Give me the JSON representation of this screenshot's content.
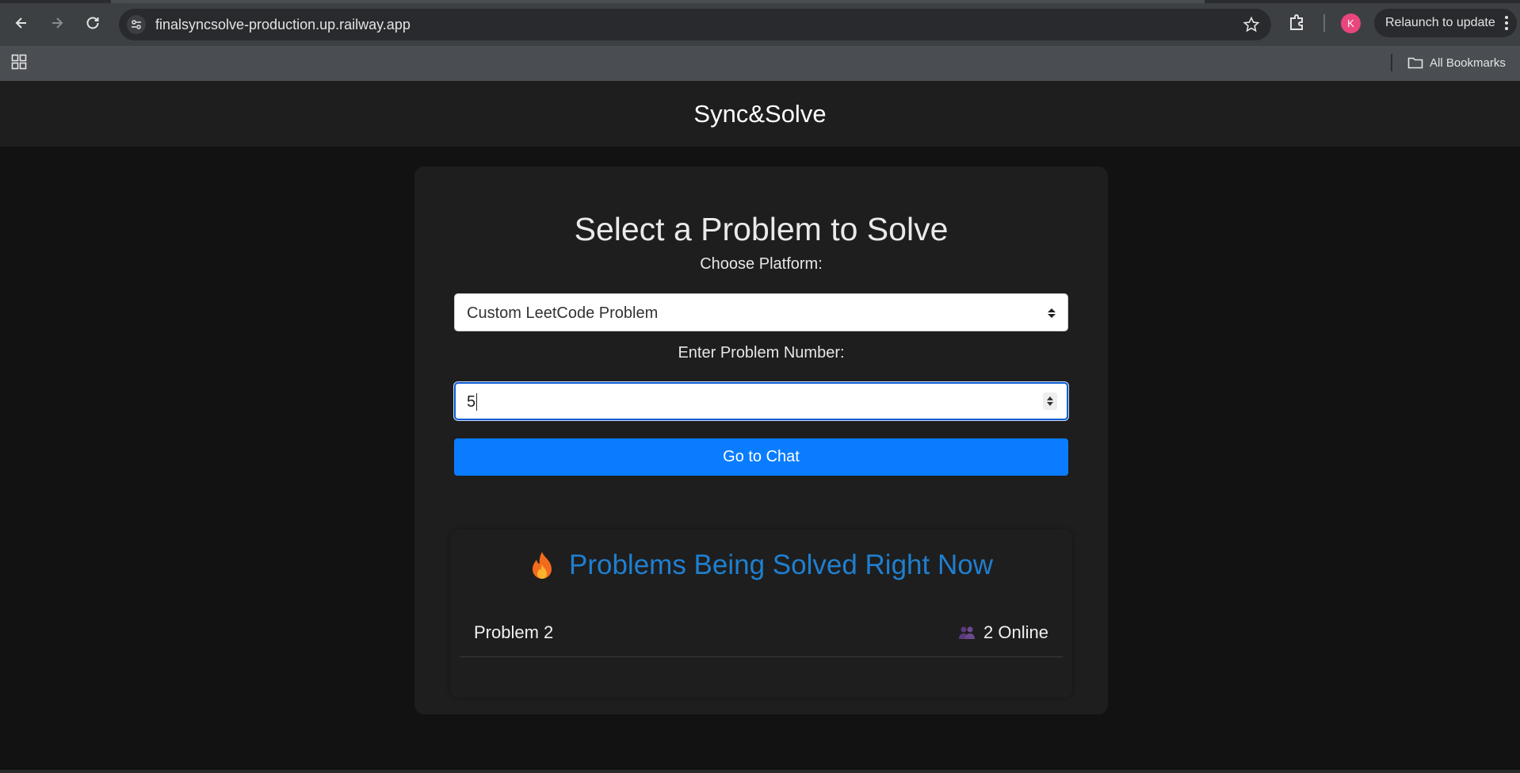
{
  "browser": {
    "url": "finalsyncsolve-production.up.railway.app",
    "relaunch_label": "Relaunch to update",
    "avatar_letter": "K",
    "all_bookmarks_label": "All Bookmarks"
  },
  "header": {
    "title": "Sync&Solve"
  },
  "form": {
    "heading": "Select a Problem to Solve",
    "platform_label": "Choose Platform:",
    "platform_selected": "Custom LeetCode Problem",
    "number_label": "Enter Problem Number:",
    "number_value": "5",
    "submit_label": "Go to Chat"
  },
  "live": {
    "heading": "Problems Being Solved Right Now",
    "items": [
      {
        "name": "Problem 2",
        "online": "2 Online"
      }
    ]
  },
  "colors": {
    "accent_button": "#0a7cff",
    "live_heading": "#1f7fd0",
    "background": "#121212",
    "card": "#1e1e1e"
  }
}
